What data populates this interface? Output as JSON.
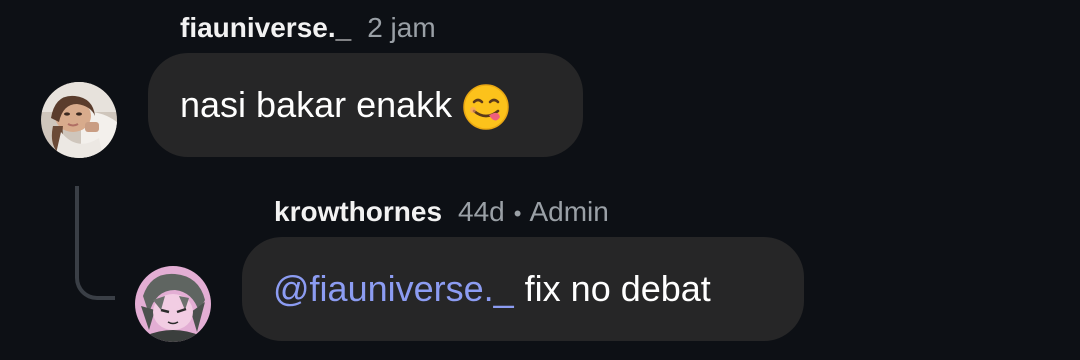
{
  "comments": [
    {
      "username": "fiauniverse._",
      "time": "2 jam",
      "text": "nasi bakar enakk",
      "emoji": "yum-face-emoji"
    },
    {
      "username": "krowthornes",
      "time": "44d",
      "separator": "•",
      "role": "Admin",
      "mention": "@fiauniverse._",
      "text": "fix no debat"
    }
  ],
  "colors": {
    "background": "#0d1015",
    "bubble": "#262627",
    "mention": "#8c9cf2",
    "meta": "#9aa0a6",
    "thread_line": "#3a3f46"
  }
}
